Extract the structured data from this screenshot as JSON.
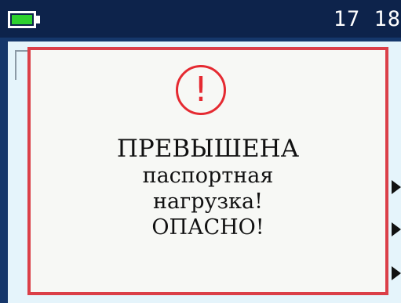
{
  "status_bar": {
    "time": "17 18",
    "battery_level": 1.0,
    "battery_color": "#2ed12e",
    "background_color": "#0d234b"
  },
  "alert": {
    "icon": "exclamation-circle-icon",
    "icon_symbol": "!",
    "message_lines": [
      "ПРЕВЫШЕНА",
      "паспортная",
      "нагрузка!",
      "ОПАСНО!"
    ],
    "border_color": "#db3f48",
    "icon_color": "#e52a31"
  },
  "background": {
    "panel_color": "#e5f4fb",
    "arrow_icon": "triangle-right-icon"
  }
}
